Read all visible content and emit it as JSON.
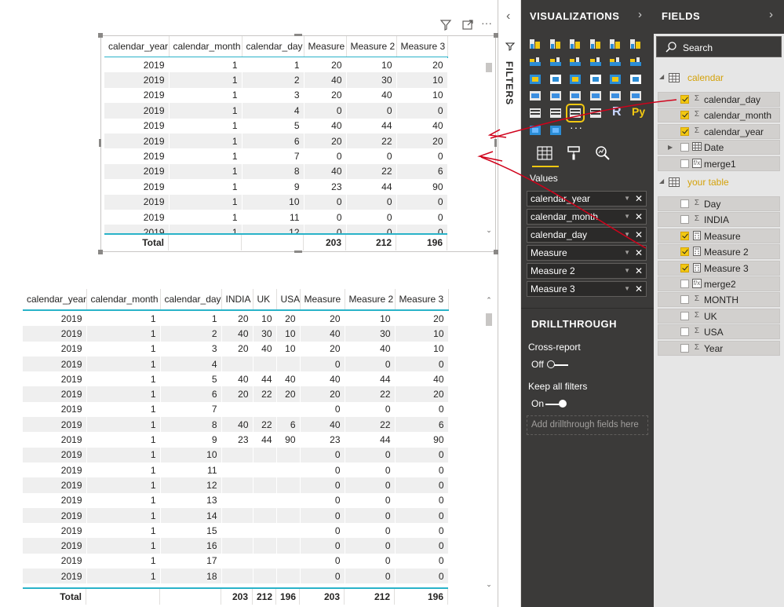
{
  "visual1": {
    "columns": [
      "calendar_year",
      "calendar_month",
      "calendar_day",
      "Measure",
      "Measure 2",
      "Measure 3"
    ],
    "rows": [
      [
        "2019",
        "1",
        "1",
        "20",
        "10",
        "20"
      ],
      [
        "2019",
        "1",
        "2",
        "40",
        "30",
        "10"
      ],
      [
        "2019",
        "1",
        "3",
        "20",
        "40",
        "10"
      ],
      [
        "2019",
        "1",
        "4",
        "0",
        "0",
        "0"
      ],
      [
        "2019",
        "1",
        "5",
        "40",
        "44",
        "40"
      ],
      [
        "2019",
        "1",
        "6",
        "20",
        "22",
        "20"
      ],
      [
        "2019",
        "1",
        "7",
        "0",
        "0",
        "0"
      ],
      [
        "2019",
        "1",
        "8",
        "40",
        "22",
        "6"
      ],
      [
        "2019",
        "1",
        "9",
        "23",
        "44",
        "90"
      ],
      [
        "2019",
        "1",
        "10",
        "0",
        "0",
        "0"
      ],
      [
        "2019",
        "1",
        "11",
        "0",
        "0",
        "0"
      ],
      [
        "2019",
        "1",
        "12",
        "0",
        "0",
        "0"
      ]
    ],
    "total": [
      "Total",
      "",
      "",
      "203",
      "212",
      "196"
    ]
  },
  "visual2": {
    "columns": [
      "calendar_year",
      "calendar_month",
      "calendar_day",
      "INDIA",
      "UK",
      "USA",
      "Measure",
      "Measure 2",
      "Measure 3"
    ],
    "rows": [
      [
        "2019",
        "1",
        "1",
        "20",
        "10",
        "20",
        "20",
        "10",
        "20"
      ],
      [
        "2019",
        "1",
        "2",
        "40",
        "30",
        "10",
        "40",
        "30",
        "10"
      ],
      [
        "2019",
        "1",
        "3",
        "20",
        "40",
        "10",
        "20",
        "40",
        "10"
      ],
      [
        "2019",
        "1",
        "4",
        "",
        "",
        "",
        "0",
        "0",
        "0"
      ],
      [
        "2019",
        "1",
        "5",
        "40",
        "44",
        "40",
        "40",
        "44",
        "40"
      ],
      [
        "2019",
        "1",
        "6",
        "20",
        "22",
        "20",
        "20",
        "22",
        "20"
      ],
      [
        "2019",
        "1",
        "7",
        "",
        "",
        "",
        "0",
        "0",
        "0"
      ],
      [
        "2019",
        "1",
        "8",
        "40",
        "22",
        "6",
        "40",
        "22",
        "6"
      ],
      [
        "2019",
        "1",
        "9",
        "23",
        "44",
        "90",
        "23",
        "44",
        "90"
      ],
      [
        "2019",
        "1",
        "10",
        "",
        "",
        "",
        "0",
        "0",
        "0"
      ],
      [
        "2019",
        "1",
        "11",
        "",
        "",
        "",
        "0",
        "0",
        "0"
      ],
      [
        "2019",
        "1",
        "12",
        "",
        "",
        "",
        "0",
        "0",
        "0"
      ],
      [
        "2019",
        "1",
        "13",
        "",
        "",
        "",
        "0",
        "0",
        "0"
      ],
      [
        "2019",
        "1",
        "14",
        "",
        "",
        "",
        "0",
        "0",
        "0"
      ],
      [
        "2019",
        "1",
        "15",
        "",
        "",
        "",
        "0",
        "0",
        "0"
      ],
      [
        "2019",
        "1",
        "16",
        "",
        "",
        "",
        "0",
        "0",
        "0"
      ],
      [
        "2019",
        "1",
        "17",
        "",
        "",
        "",
        "0",
        "0",
        "0"
      ],
      [
        "2019",
        "1",
        "18",
        "",
        "",
        "",
        "0",
        "0",
        "0"
      ]
    ],
    "total": [
      "Total",
      "",
      "",
      "203",
      "212",
      "196",
      "203",
      "212",
      "196"
    ]
  },
  "filters": {
    "label": "FILTERS"
  },
  "visualizations": {
    "title": "VISUALIZATIONS",
    "values_label": "Values",
    "wells": [
      "calendar_year",
      "calendar_month",
      "calendar_day",
      "Measure",
      "Measure 2",
      "Measure 3"
    ],
    "more_icon": "···",
    "python_label": "Py",
    "r_label": "R",
    "drillthrough": {
      "title": "DRILLTHROUGH",
      "cross_report_label": "Cross-report",
      "cross_report_state": "Off",
      "keep_filters_label": "Keep all filters",
      "keep_filters_state": "On",
      "drop_placeholder": "Add drillthrough fields here"
    }
  },
  "fields": {
    "title": "FIELDS",
    "search_placeholder": "Search",
    "tables": [
      {
        "name": "calendar",
        "fields": [
          {
            "name": "calendar_day",
            "type": "Σ",
            "checked": true
          },
          {
            "name": "calendar_month",
            "type": "Σ",
            "checked": true
          },
          {
            "name": "calendar_year",
            "type": "Σ",
            "checked": true
          },
          {
            "name": "Date",
            "type": "table",
            "checked": false,
            "expandable": true
          },
          {
            "name": "merge1",
            "type": "fx",
            "checked": false
          }
        ]
      },
      {
        "name": "your table",
        "fields": [
          {
            "name": "Day",
            "type": "Σ",
            "checked": false
          },
          {
            "name": "INDIA",
            "type": "Σ",
            "checked": false
          },
          {
            "name": "Measure",
            "type": "calc",
            "checked": true
          },
          {
            "name": "Measure 2",
            "type": "calc",
            "checked": true
          },
          {
            "name": "Measure 3",
            "type": "calc",
            "checked": true
          },
          {
            "name": "merge2",
            "type": "fx",
            "checked": false
          },
          {
            "name": "MONTH",
            "type": "Σ",
            "checked": false
          },
          {
            "name": "UK",
            "type": "Σ",
            "checked": false
          },
          {
            "name": "USA",
            "type": "Σ",
            "checked": false
          },
          {
            "name": "Year",
            "type": "Σ",
            "checked": false
          }
        ]
      }
    ]
  },
  "colors": {
    "accent_yellow": "#f2c811",
    "table_header_rule": "#2ab3c9",
    "pane_dark": "#3b3a39",
    "fields_bg": "#e6e6e6",
    "annotation_red": "#d0021b"
  }
}
